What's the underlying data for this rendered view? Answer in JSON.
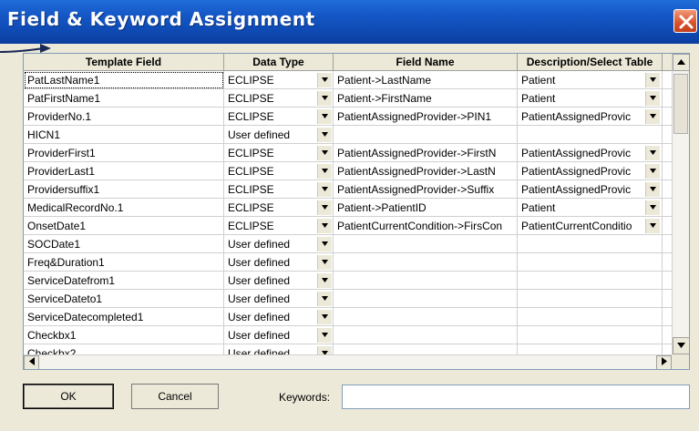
{
  "window": {
    "title": "Field & Keyword Assignment"
  },
  "grid": {
    "columns": [
      "Template Field",
      "Data Type",
      "Field Name",
      "Description/Select Table"
    ],
    "rows": [
      {
        "template_field": "PatLastName1",
        "data_type": "ECLIPSE",
        "field_name": "Patient->LastName",
        "description": "Patient"
      },
      {
        "template_field": "PatFirstName1",
        "data_type": "ECLIPSE",
        "field_name": "Patient->FirstName",
        "description": "Patient"
      },
      {
        "template_field": "ProviderNo.1",
        "data_type": "ECLIPSE",
        "field_name": "PatientAssignedProvider->PIN1",
        "description": "PatientAssignedProvic"
      },
      {
        "template_field": "HICN1",
        "data_type": "User defined",
        "field_name": "",
        "description": ""
      },
      {
        "template_field": "ProviderFirst1",
        "data_type": "ECLIPSE",
        "field_name": "PatientAssignedProvider->FirstN",
        "description": "PatientAssignedProvic"
      },
      {
        "template_field": "ProviderLast1",
        "data_type": "ECLIPSE",
        "field_name": "PatientAssignedProvider->LastN",
        "description": "PatientAssignedProvic"
      },
      {
        "template_field": "Providersuffix1",
        "data_type": "ECLIPSE",
        "field_name": "PatientAssignedProvider->Suffix",
        "description": "PatientAssignedProvic"
      },
      {
        "template_field": "MedicalRecordNo.1",
        "data_type": "ECLIPSE",
        "field_name": "Patient->PatientID",
        "description": "Patient"
      },
      {
        "template_field": "OnsetDate1",
        "data_type": "ECLIPSE",
        "field_name": "PatientCurrentCondition->FirsCon",
        "description": "PatientCurrentConditio"
      },
      {
        "template_field": "SOCDate1",
        "data_type": "User defined",
        "field_name": "",
        "description": ""
      },
      {
        "template_field": "Freq&Duration1",
        "data_type": "User defined",
        "field_name": "",
        "description": ""
      },
      {
        "template_field": "ServiceDatefrom1",
        "data_type": "User defined",
        "field_name": "",
        "description": ""
      },
      {
        "template_field": "ServiceDateto1",
        "data_type": "User defined",
        "field_name": "",
        "description": ""
      },
      {
        "template_field": "ServiceDatecompleted1",
        "data_type": "User defined",
        "field_name": "",
        "description": ""
      },
      {
        "template_field": "Checkbx1",
        "data_type": "User defined",
        "field_name": "",
        "description": ""
      },
      {
        "template_field": "Checkbx2",
        "data_type": "User defined",
        "field_name": "",
        "description": ""
      }
    ]
  },
  "buttons": {
    "ok": "OK",
    "cancel": "Cancel"
  },
  "keywords": {
    "label": "Keywords:",
    "value": ""
  },
  "icons": {
    "close": "close-icon",
    "dropdown": "chevron-down-icon",
    "annotation": "arrow-icon"
  },
  "colors": {
    "titlebar": "#1557C6",
    "close": "#D9512B",
    "window": "#ECE9D8"
  }
}
